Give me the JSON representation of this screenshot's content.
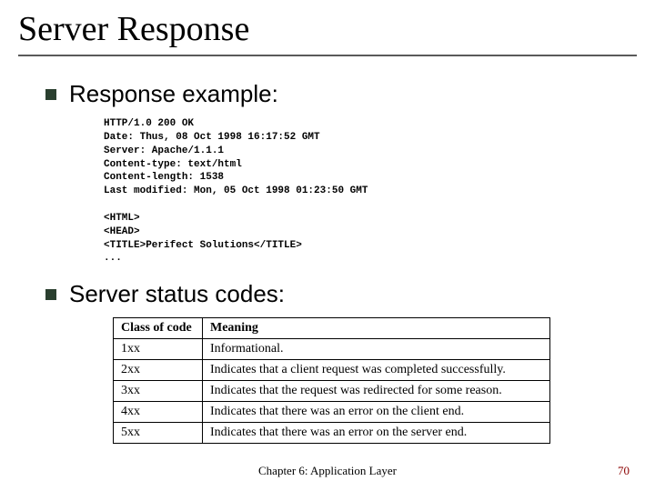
{
  "title": "Server Response",
  "bullets": {
    "example_label": "Response example:",
    "status_label": "Server status codes:"
  },
  "http_response": {
    "line1": "HTTP/1.0 200 OK",
    "line2": "Date: Thus, 08 Oct 1998 16:17:52 GMT",
    "line3": "Server: Apache/1.1.1",
    "line4": "Content-type: text/html",
    "line5": "Content-length: 1538",
    "line6": "Last modified: Mon, 05 Oct 1998 01:23:50 GMT",
    "blank": "",
    "line7": "<HTML>",
    "line8": "<HEAD>",
    "line9": "<TITLE>Perifect Solutions</TITLE>",
    "line10": "..."
  },
  "table": {
    "header_class": "Class of code",
    "header_meaning": "Meaning",
    "rows": [
      {
        "code": "1xx",
        "meaning": "Informational."
      },
      {
        "code": "2xx",
        "meaning": "Indicates that a client request was completed successfully."
      },
      {
        "code": "3xx",
        "meaning": "Indicates that the request was redirected for some reason."
      },
      {
        "code": "4xx",
        "meaning": "Indicates that there was an error on the client end."
      },
      {
        "code": "5xx",
        "meaning": "Indicates that there was an error on the server end."
      }
    ]
  },
  "footer": "Chapter 6: Application Layer",
  "page_number": "70"
}
